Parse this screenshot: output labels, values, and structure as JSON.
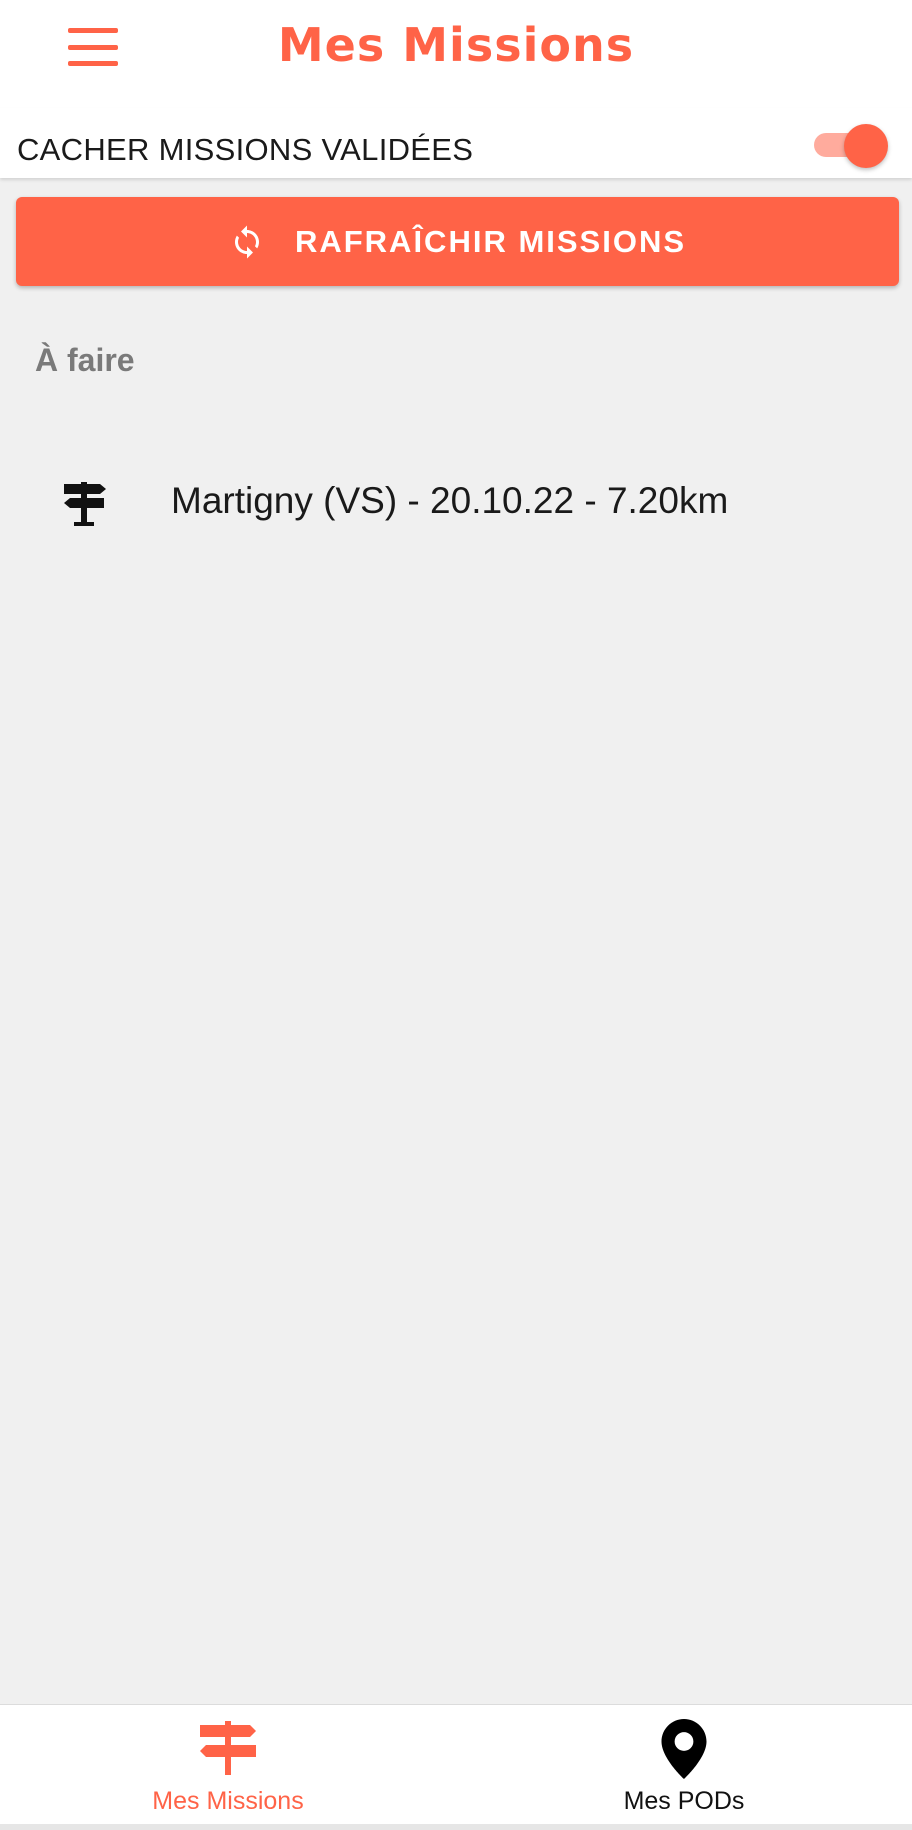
{
  "header": {
    "title": "Mes Missions",
    "menu_icon": "hamburger-menu-icon"
  },
  "filter": {
    "label": "CACHER MISSIONS VALIDÉES",
    "enabled": true
  },
  "refresh": {
    "label": "RAFRAÎCHIR MISSIONS",
    "icon": "refresh-icon"
  },
  "section": {
    "title": "À faire",
    "items": [
      {
        "icon": "signpost-icon",
        "text": "Martigny (VS) - 20.10.22 - 7.20km"
      }
    ]
  },
  "bottom_nav": {
    "items": [
      {
        "label": "Mes Missions",
        "icon": "signpost-icon",
        "active": true
      },
      {
        "label": "Mes PODs",
        "icon": "map-pin-icon",
        "active": false
      }
    ]
  },
  "colors": {
    "accent": "#ff6347",
    "accent_light": "#ffab9d",
    "background": "#f0f0f0",
    "section_text": "#7a7a7a"
  }
}
